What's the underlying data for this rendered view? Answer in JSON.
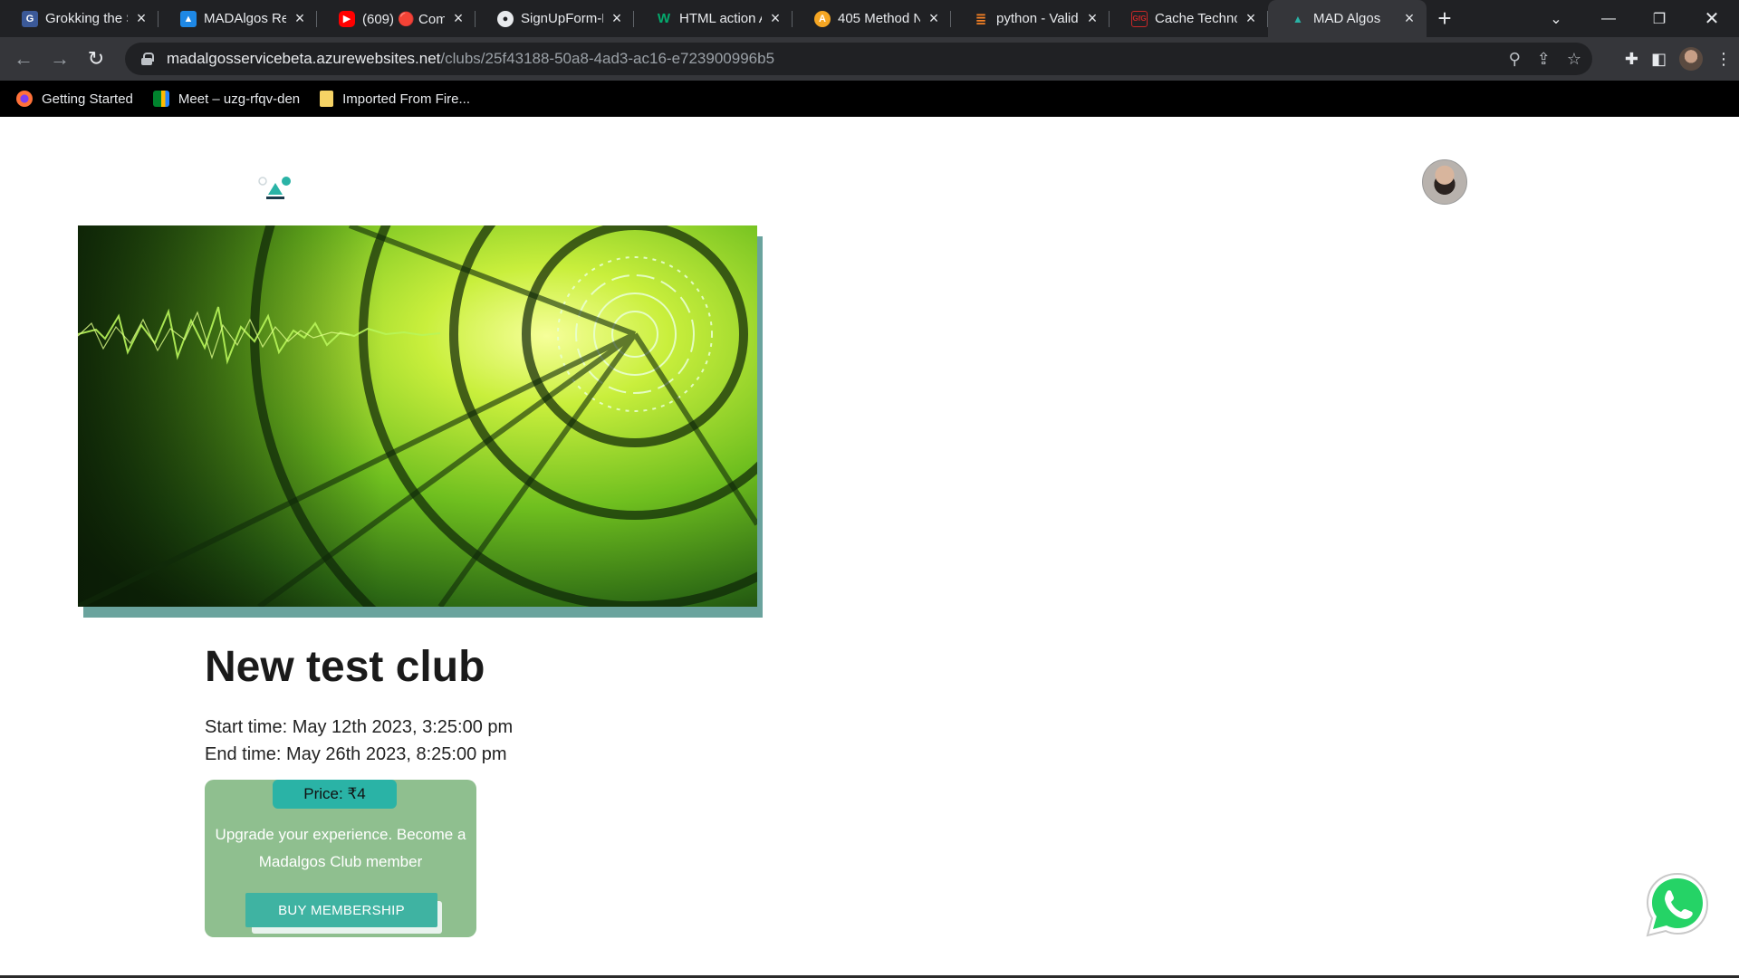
{
  "browser": {
    "tabs": [
      {
        "title": "Grokking the S",
        "icon": "doc-icon",
        "color": "#3b5998"
      },
      {
        "title": "MADAlgos Rel",
        "icon": "azure-icon",
        "color": "#1e88e5"
      },
      {
        "title": "(609) 🔴 Comp",
        "icon": "youtube-icon",
        "color": "#ff0000"
      },
      {
        "title": "SignUpForm-H",
        "icon": "github-icon",
        "color": "#ffffff"
      },
      {
        "title": "HTML action A",
        "icon": "w-icon",
        "color": "#04aa6d"
      },
      {
        "title": "405 Method N",
        "icon": "a-icon",
        "color": "#f5a623"
      },
      {
        "title": "python - Valid",
        "icon": "stackoverflow-icon",
        "color": "#f48024"
      },
      {
        "title": "Cache Technol",
        "icon": "site-icon",
        "color": "#c62828"
      },
      {
        "title": "MAD Algos",
        "icon": "madalgos-icon",
        "color": "#2ab3a6"
      }
    ],
    "new_tab": "+",
    "url_host": "madalgosservicebeta.azurewebsites.net",
    "url_path": "/clubs/25f43188-50a8-4ad3-ac16-e723900996b5",
    "bookmarks": [
      {
        "label": "Getting Started",
        "icon": "firefox-icon"
      },
      {
        "label": "Meet – uzg-rfqv-den",
        "icon": "meet-icon"
      },
      {
        "label": "Imported From Fire...",
        "icon": "folder-icon"
      }
    ]
  },
  "club": {
    "title": "New test club",
    "start_time": "Start time: May 12th 2023, 3:25:00 pm",
    "end_time": "End time: May 26th 2023, 8:25:00 pm",
    "price": "Price: ₹4",
    "upsell_text": "Upgrade your experience. Become a Madalgos Club member",
    "buy_button": "BUY MEMBERSHIP"
  },
  "colors": {
    "accent": "#2ab3a6",
    "card_bg": "#8fbf8f",
    "image_shadow": "#6aa39d"
  }
}
